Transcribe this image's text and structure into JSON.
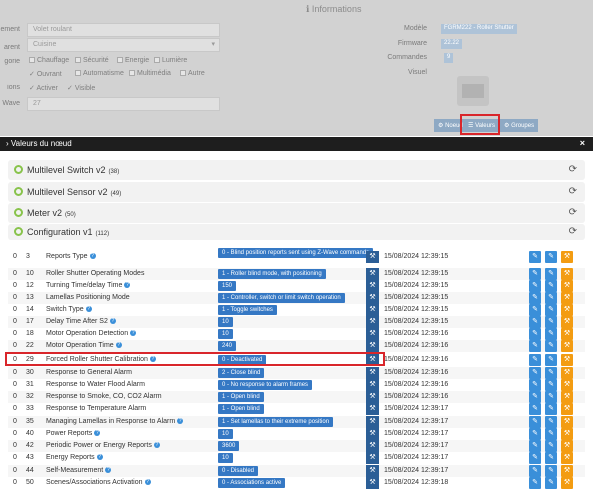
{
  "bg_form": {
    "title": "Informations",
    "labels": [
      "ement",
      "arent",
      "gorie",
      "ions",
      "Wave"
    ],
    "name_value": "Volet roulant",
    "parent_value": "Cuisine",
    "categories": [
      "Chauffage",
      "Sécurité",
      "Energie",
      "Lumière",
      "Ouvrant",
      "Automatisme",
      "Multimédia",
      "Autre"
    ],
    "options": [
      "Activer",
      "Visible"
    ],
    "wave_value": "27",
    "right_labels": [
      "Modèle",
      "Firmware",
      "Commandes",
      "Visuel"
    ],
    "model_value": "FGRM222 - Roller Shutter",
    "firmware_value": "22.22",
    "commands_value": "9",
    "buttons": [
      "Noeud",
      "Valeurs",
      "Groupes"
    ]
  },
  "dialog": {
    "title": "Valeurs du nœud",
    "close": "×"
  },
  "sections": [
    {
      "name": "Multilevel Switch v2",
      "count": "(38)"
    },
    {
      "name": "Multilevel Sensor v2",
      "count": "(49)"
    },
    {
      "name": "Meter v2",
      "count": "(50)"
    },
    {
      "name": "Configuration v1",
      "count": "(112)"
    }
  ],
  "rows": [
    {
      "instance": "0",
      "index": "3",
      "name": "Reports Type",
      "value": "0 - Blind position reports sent using Z-Wave commands",
      "time": "15/08/2024 12:39:15"
    },
    {
      "instance": "0",
      "index": "10",
      "name": "Roller Shutter Operating Modes",
      "value": "1 - Roller blind mode, with positioning",
      "time": "15/08/2024 12:39:15"
    },
    {
      "instance": "0",
      "index": "12",
      "name": "Turning Time/delay Time",
      "value": "150",
      "time": "15/08/2024 12:39:15"
    },
    {
      "instance": "0",
      "index": "13",
      "name": "Lamellas Positioning Mode",
      "value": "1 - Controller, switch or limit switch operation",
      "time": "15/08/2024 12:39:15"
    },
    {
      "instance": "0",
      "index": "14",
      "name": "Switch Type",
      "value": "1 - Toggle switches",
      "time": "15/08/2024 12:39:15"
    },
    {
      "instance": "0",
      "index": "17",
      "name": "Delay Time After S2",
      "value": "10",
      "time": "15/08/2024 12:39:15"
    },
    {
      "instance": "0",
      "index": "18",
      "name": "Motor Operation Detection",
      "value": "10",
      "time": "15/08/2024 12:39:16"
    },
    {
      "instance": "0",
      "index": "22",
      "name": "Motor Operation Time",
      "value": "240",
      "time": "15/08/2024 12:39:16"
    },
    {
      "instance": "0",
      "index": "29",
      "name": "Forced Roller Shutter Calibration",
      "value": "0 - Deactivated",
      "time": "15/08/2024 12:39:16"
    },
    {
      "instance": "0",
      "index": "30",
      "name": "Response to General Alarm",
      "value": "2 - Close blind",
      "time": "15/08/2024 12:39:16"
    },
    {
      "instance": "0",
      "index": "31",
      "name": "Response to Water Flood Alarm",
      "value": "0 - No response to alarm frames",
      "time": "15/08/2024 12:39:16"
    },
    {
      "instance": "0",
      "index": "32",
      "name": "Response to Smoke, CO, CO2 Alarm",
      "value": "1 - Open blind",
      "time": "15/08/2024 12:39:16"
    },
    {
      "instance": "0",
      "index": "33",
      "name": "Response to Temperature Alarm",
      "value": "1 - Open blind",
      "time": "15/08/2024 12:39:17"
    },
    {
      "instance": "0",
      "index": "35",
      "name": "Managing Lamellas in Response to Alarm",
      "value": "1 - Set lamellas to their extreme position",
      "time": "15/08/2024 12:39:17"
    },
    {
      "instance": "0",
      "index": "40",
      "name": "Power Reports",
      "value": "10",
      "time": "15/08/2024 12:39:17"
    },
    {
      "instance": "0",
      "index": "42",
      "name": "Periodic Power or Energy Reports",
      "value": "3600",
      "time": "15/08/2024 12:39:17"
    },
    {
      "instance": "0",
      "index": "43",
      "name": "Energy Reports",
      "value": "10",
      "time": "15/08/2024 12:39:17"
    },
    {
      "instance": "0",
      "index": "44",
      "name": "Self-Measurement",
      "value": "0 - Disabled",
      "time": "15/08/2024 12:39:17"
    },
    {
      "instance": "0",
      "index": "50",
      "name": "Scenes/Associations Activation",
      "value": "0 - Associations active",
      "time": "15/08/2024 12:39:18"
    }
  ],
  "icons": {
    "refresh": "refresh-icon",
    "help": "help-icon",
    "wrench": "wrench-icon",
    "edit": "pencil-icon"
  },
  "colors": {
    "accent": "#3578c4",
    "warning": "#f39c12",
    "highlight": "#d9262b",
    "ok": "#88c34b"
  }
}
